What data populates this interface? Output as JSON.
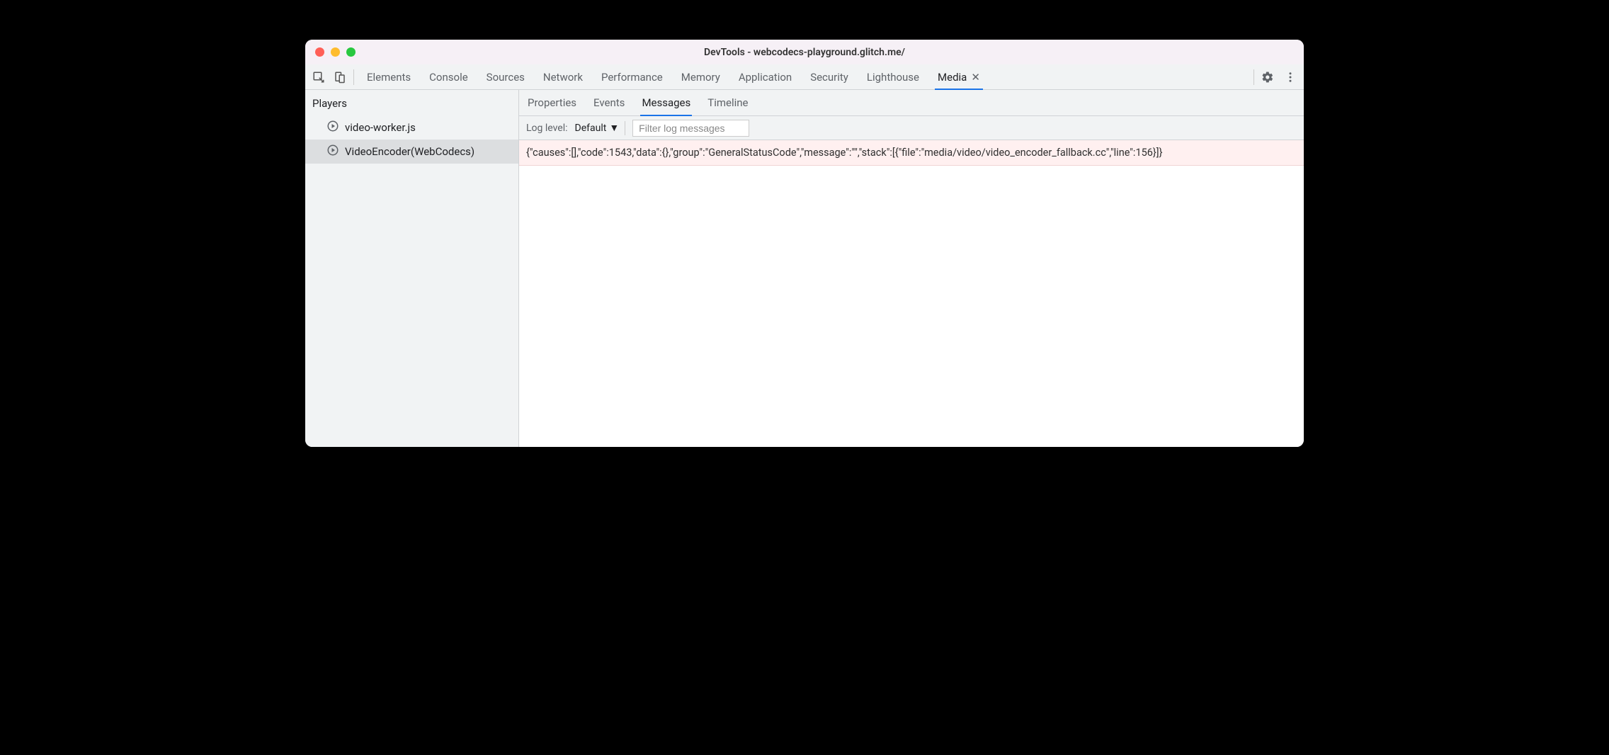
{
  "window": {
    "title": "DevTools - webcodecs-playground.glitch.me/"
  },
  "tabs": {
    "items": [
      "Elements",
      "Console",
      "Sources",
      "Network",
      "Performance",
      "Memory",
      "Application",
      "Security",
      "Lighthouse",
      "Media"
    ],
    "active": "Media"
  },
  "sidebar": {
    "title": "Players",
    "players": [
      {
        "label": "video-worker.js",
        "selected": false
      },
      {
        "label": "VideoEncoder(WebCodecs)",
        "selected": true
      }
    ]
  },
  "subtabs": {
    "items": [
      "Properties",
      "Events",
      "Messages",
      "Timeline"
    ],
    "active": "Messages"
  },
  "filterbar": {
    "log_level_label": "Log level:",
    "log_level_value": "Default",
    "filter_placeholder": "Filter log messages"
  },
  "log": {
    "rows": [
      "{\"causes\":[],\"code\":1543,\"data\":{},\"group\":\"GeneralStatusCode\",\"message\":\"\",\"stack\":[{\"file\":\"media/video/video_encoder_fallback.cc\",\"line\":156}]}"
    ]
  }
}
